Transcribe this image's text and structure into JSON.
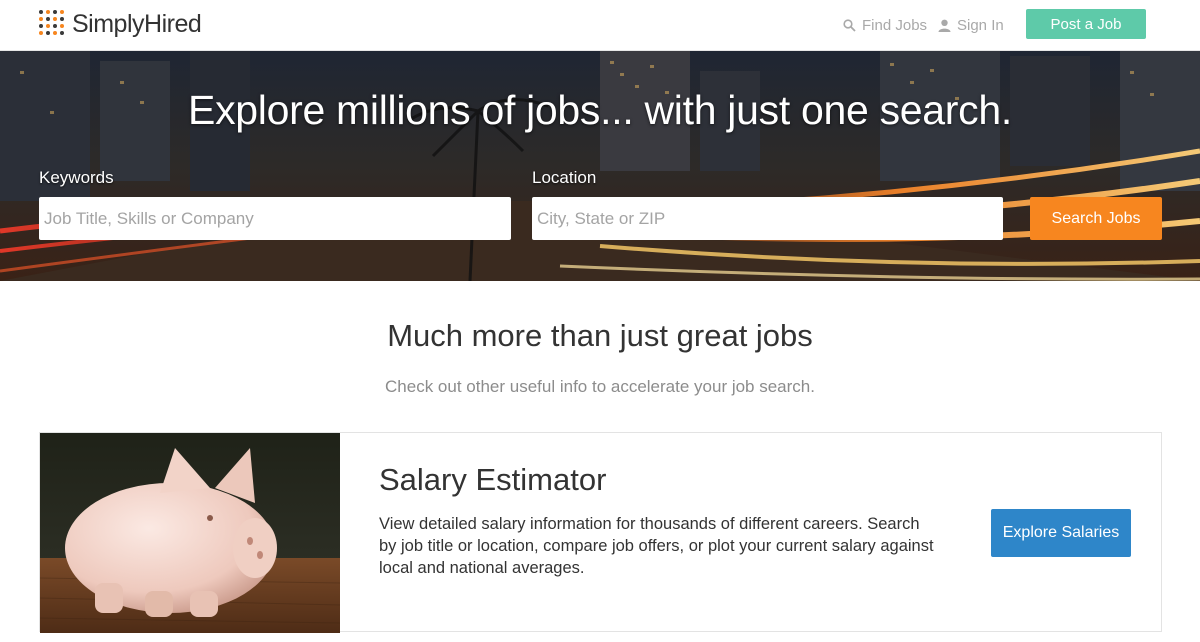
{
  "header": {
    "logo_text": "SimplyHired",
    "nav_find_jobs": "Find Jobs",
    "nav_sign_in": "Sign In",
    "post_job_label": "Post a Job"
  },
  "hero": {
    "title": "Explore millions of jobs... with just one search.",
    "keywords_label": "Keywords",
    "keywords_placeholder": "Job Title, Skills or Company",
    "keywords_value": "",
    "location_label": "Location",
    "location_placeholder": "City, State or ZIP",
    "location_value": "",
    "search_label": "Search Jobs"
  },
  "section": {
    "title": "Much more than just great jobs",
    "subtitle": "Check out other useful info to accelerate your job search."
  },
  "card": {
    "title": "Salary Estimator",
    "description": "View detailed salary information for thousands of different careers. Search by job title or location, compare job offers, or plot your current salary against local and national averages.",
    "button_label": "Explore Salaries",
    "image": "piggy-bank-image"
  },
  "colors": {
    "post_job_green": "#5ecaa9",
    "search_orange": "#f7861f",
    "explore_blue": "#2e86c9"
  },
  "icons": {
    "find_jobs": "search-icon",
    "sign_in": "user-icon"
  }
}
